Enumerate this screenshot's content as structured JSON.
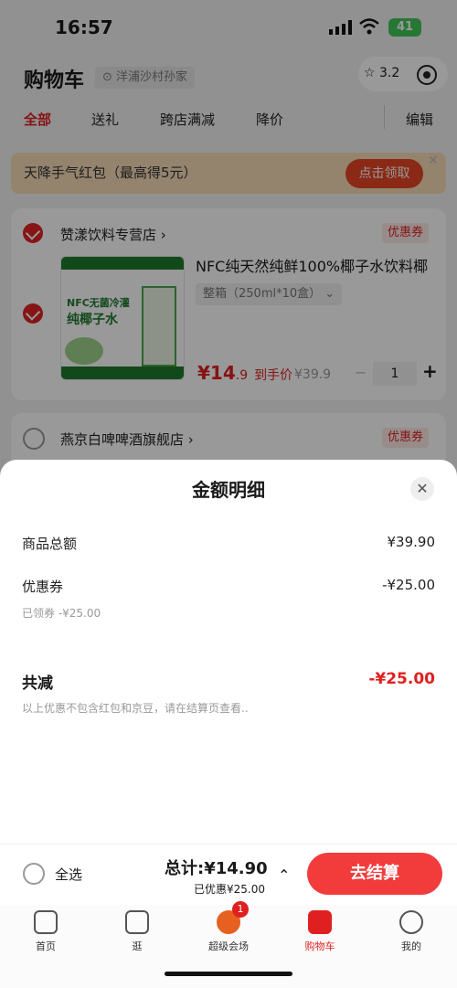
{
  "status": {
    "time": "16:57",
    "battery": "41"
  },
  "header": {
    "title": "购物车",
    "location": "洋浦沙村孙家",
    "score": "3.2"
  },
  "tabs": [
    {
      "label": "全部",
      "active": true
    },
    {
      "label": "送礼"
    },
    {
      "label": "跨店满减"
    },
    {
      "label": "降价"
    }
  ],
  "edit_label": "编辑",
  "banner": {
    "text": "天降手气红包（最高得5元）",
    "button": "点击领取"
  },
  "stores": [
    {
      "name": "赞漾饮料专营店 ›",
      "badge": "优惠券",
      "product": {
        "name": "NFC纯天然纯鲜100%椰子水饮料椰",
        "spec": "整箱（250ml*10盒）",
        "price_big": "¥14",
        "price_small": ".9",
        "price_suffix": "到手价",
        "original": "¥39.9",
        "qty": "1",
        "image_text1": "NFC无菌冷灌",
        "image_text2": "纯椰子水"
      }
    },
    {
      "name": "燕京白啤啤酒旗舰店 ›",
      "badge": "优惠券"
    }
  ],
  "sheet": {
    "title": "金额明细",
    "rows": [
      {
        "label": "商品总额",
        "value": "¥39.90"
      },
      {
        "label": "优惠券",
        "value": "-¥25.00",
        "sub": "已领券 -¥25.00"
      }
    ],
    "total_label": "共减",
    "total_value": "-¥25.00",
    "note": "以上优惠不包含红包和京豆，请在结算页查看.."
  },
  "checkout": {
    "select_all": "全选",
    "total": "总计:¥14.90",
    "discount": "已优惠¥25.00",
    "button": "去结算"
  },
  "nav": [
    {
      "label": "首页"
    },
    {
      "label": "逛"
    },
    {
      "label": "超级会场",
      "badge": "1"
    },
    {
      "label": "购物车",
      "active": true
    },
    {
      "label": "我的"
    }
  ],
  "colors": {
    "accent": "#e02020",
    "banner_bg": "#f7ddb7",
    "pay_button": "#f23c3c"
  }
}
